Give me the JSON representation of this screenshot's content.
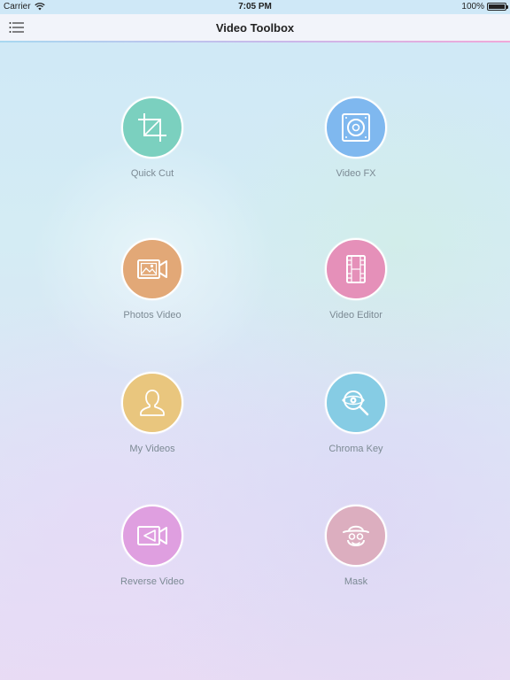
{
  "status_bar": {
    "carrier": "Carrier",
    "time": "7:05 PM",
    "battery": "100%",
    "wifi_icon": "wifi-icon",
    "battery_icon": "battery-icon"
  },
  "nav": {
    "title": "Video Toolbox",
    "menu_icon": "list-menu-icon"
  },
  "colors": {
    "quick_cut": "#7bd0bf",
    "video_fx": "#7fb8ef",
    "photos_video": "#e2a877",
    "video_editor": "#e590b9",
    "my_videos": "#e9c67e",
    "chroma_key": "#86cce4",
    "reverse_video": "#df9fe0",
    "mask": "#dcaebf"
  },
  "tools": {
    "quick_cut": {
      "label": "Quick Cut",
      "icon": "crop-icon"
    },
    "video_fx": {
      "label": "Video FX",
      "icon": "speaker-icon"
    },
    "photos_video": {
      "label": "Photos Video",
      "icon": "photo-video-icon"
    },
    "video_editor": {
      "label": "Video Editor",
      "icon": "film-strip-icon"
    },
    "my_videos": {
      "label": "My Videos",
      "icon": "person-icon"
    },
    "chroma_key": {
      "label": "Chroma Key",
      "icon": "eye-magnifier-icon"
    },
    "reverse_video": {
      "label": "Reverse Video",
      "icon": "reverse-camera-icon"
    },
    "mask": {
      "label": "Mask",
      "icon": "mask-face-icon"
    }
  }
}
